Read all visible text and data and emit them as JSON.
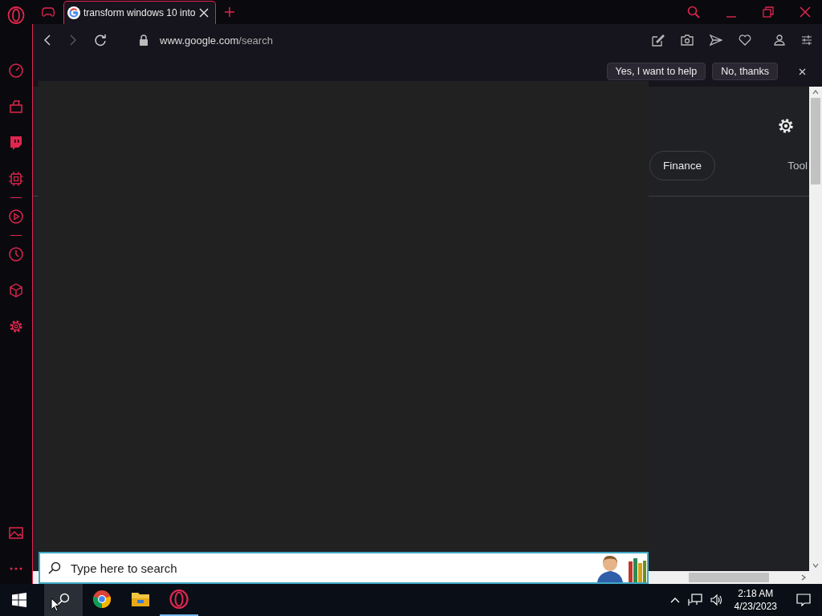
{
  "browser": {
    "tabs": [
      {
        "title": "transform windows 10 into",
        "selected": true
      }
    ],
    "address": {
      "host": "www.google.com",
      "path": "/search"
    }
  },
  "infobar": {
    "buttons": [
      {
        "label": "Yes, I want to help"
      },
      {
        "label": "No, thanks"
      }
    ]
  },
  "page": {
    "chips": [
      {
        "label": "Finance"
      }
    ],
    "tools": "Tool"
  },
  "search_panel": {
    "placeholder": "Type here to search"
  },
  "taskbar": {
    "apps": [
      {
        "kind": "search",
        "highlighted": true,
        "running": false
      },
      {
        "kind": "chrome",
        "highlighted": false,
        "running": false
      },
      {
        "kind": "explorer",
        "highlighted": false,
        "running": false
      },
      {
        "kind": "opera",
        "highlighted": false,
        "running": true
      }
    ],
    "clock": {
      "time": "2:18 AM",
      "date": "4/23/2023"
    }
  }
}
